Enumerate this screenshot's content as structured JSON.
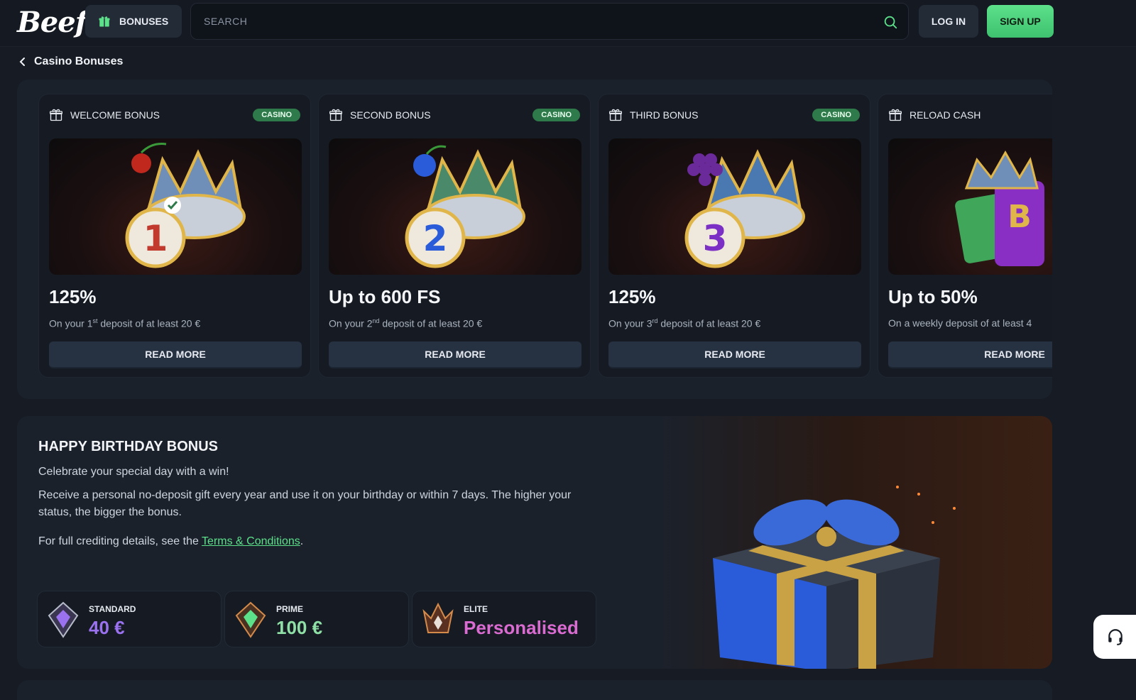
{
  "header": {
    "logo": "Beef",
    "bonuses_label": "BONUSES",
    "search_placeholder": "SEARCH",
    "login_label": "LOG IN",
    "signup_label": "SIGN UP"
  },
  "breadcrumb": {
    "label": "Casino Bonuses"
  },
  "cards": [
    {
      "name": "WELCOME BONUS",
      "badge": "CASINO",
      "title": "125%",
      "desc_pre": "On your 1",
      "desc_sup": "st",
      "desc_post": " deposit of at least 20 €",
      "button": "READ MORE",
      "art_number": "1",
      "art_color": "#c23a2e"
    },
    {
      "name": "SECOND BONUS",
      "badge": "CASINO",
      "title": "Up to 600 FS",
      "desc_pre": "On your 2",
      "desc_sup": "nd",
      "desc_post": " deposit of at least 20 €",
      "button": "READ MORE",
      "art_number": "2",
      "art_color": "#2a5bd8"
    },
    {
      "name": "THIRD BONUS",
      "badge": "CASINO",
      "title": "125%",
      "desc_pre": "On your 3",
      "desc_sup": "rd",
      "desc_post": " deposit of at least 20 €",
      "button": "READ MORE",
      "art_number": "3",
      "art_color": "#7b2fc4"
    },
    {
      "name": "RELOAD CASH",
      "badge": "",
      "title": "Up to 50%",
      "desc_pre": "On a weekly deposit of at least 4",
      "desc_sup": "",
      "desc_post": "",
      "button": "READ MORE",
      "art_number": "B",
      "art_color": "#c9952f"
    }
  ],
  "birthday": {
    "title": "HAPPY BIRTHDAY BONUS",
    "subtitle": "Celebrate your special day with a win!",
    "body": "Receive a personal no-deposit gift every year and use it on your birthday or within 7 days. The higher your status, the bigger the bonus.",
    "terms_pre": "For full crediting details, see the ",
    "terms_link": "Terms & Conditions",
    "terms_post": "."
  },
  "tiers": [
    {
      "label": "STANDARD",
      "value": "40 €",
      "color": "#9a72f0"
    },
    {
      "label": "PRIME",
      "value": "100 €",
      "color": "#8fe0a6"
    },
    {
      "label": "ELITE",
      "value": "Personalised",
      "color": "#d96bd1"
    }
  ],
  "colors": {
    "accent_green": "#5ce08a",
    "badge_green": "#2f7a4a",
    "background": "#161b24"
  }
}
